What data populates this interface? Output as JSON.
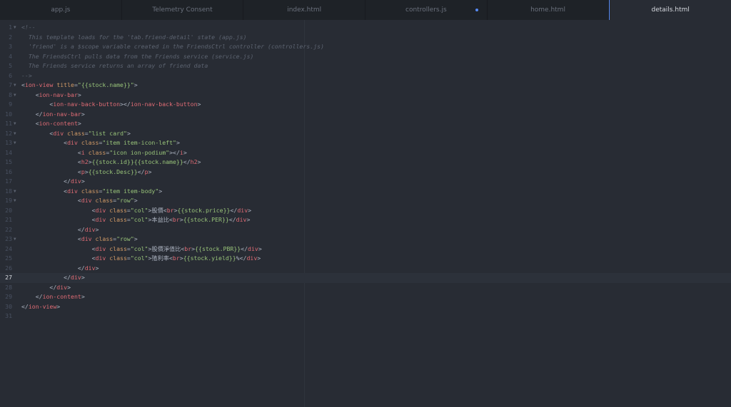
{
  "tabs": [
    {
      "label": "app.js"
    },
    {
      "label": "Telemetry Consent"
    },
    {
      "label": "index.html"
    },
    {
      "label": "controllers.js",
      "modified": true
    },
    {
      "label": "home.html"
    },
    {
      "label": "details.html",
      "active": true
    }
  ],
  "editor": {
    "current_line": 27,
    "lines": [
      {
        "n": "1",
        "fold": true,
        "tokens": [
          {
            "c": "c",
            "t": "<!--"
          }
        ]
      },
      {
        "n": "2",
        "tokens": [
          {
            "c": "c",
            "t": "  This template loads for the 'tab.friend-detail' state (app.js)"
          }
        ]
      },
      {
        "n": "3",
        "tokens": [
          {
            "c": "c",
            "t": "  'friend' is a $scope variable created in the FriendsCtrl controller (controllers.js)"
          }
        ]
      },
      {
        "n": "4",
        "tokens": [
          {
            "c": "c",
            "t": "  The FriendsCtrl pulls data from the Friends service (service.js)"
          }
        ]
      },
      {
        "n": "5",
        "tokens": [
          {
            "c": "c",
            "t": "  The Friends service returns an array of friend data"
          }
        ]
      },
      {
        "n": "6",
        "tokens": [
          {
            "c": "c",
            "t": "-->"
          }
        ]
      },
      {
        "n": "7",
        "fold": true,
        "tokens": [
          {
            "c": "p",
            "t": "<"
          },
          {
            "c": "t",
            "t": "ion-view"
          },
          {
            "c": "p",
            "t": " "
          },
          {
            "c": "a",
            "t": "title"
          },
          {
            "c": "p",
            "t": "="
          },
          {
            "c": "s",
            "t": "\"{{stock.name}}\""
          },
          {
            "c": "p",
            "t": ">"
          }
        ]
      },
      {
        "n": "8",
        "fold": true,
        "tokens": [
          {
            "c": "p",
            "t": "    <"
          },
          {
            "c": "t",
            "t": "ion-nav-bar"
          },
          {
            "c": "p",
            "t": ">"
          }
        ]
      },
      {
        "n": "9",
        "tokens": [
          {
            "c": "p",
            "t": "        <"
          },
          {
            "c": "t",
            "t": "ion-nav-back-button"
          },
          {
            "c": "p",
            "t": "></"
          },
          {
            "c": "t",
            "t": "ion-nav-back-button"
          },
          {
            "c": "p",
            "t": ">"
          }
        ]
      },
      {
        "n": "10",
        "tokens": [
          {
            "c": "p",
            "t": "    </"
          },
          {
            "c": "t",
            "t": "ion-nav-bar"
          },
          {
            "c": "p",
            "t": ">"
          }
        ]
      },
      {
        "n": "11",
        "fold": true,
        "tokens": [
          {
            "c": "p",
            "t": "    <"
          },
          {
            "c": "t",
            "t": "ion-content"
          },
          {
            "c": "p",
            "t": ">"
          }
        ]
      },
      {
        "n": "12",
        "fold": true,
        "tokens": [
          {
            "c": "p",
            "t": "        <"
          },
          {
            "c": "t",
            "t": "div"
          },
          {
            "c": "p",
            "t": " "
          },
          {
            "c": "a",
            "t": "class"
          },
          {
            "c": "p",
            "t": "="
          },
          {
            "c": "s",
            "t": "\"list card\""
          },
          {
            "c": "p",
            "t": ">"
          }
        ]
      },
      {
        "n": "13",
        "fold": true,
        "tokens": [
          {
            "c": "p",
            "t": "            <"
          },
          {
            "c": "t",
            "t": "div"
          },
          {
            "c": "p",
            "t": " "
          },
          {
            "c": "a",
            "t": "class"
          },
          {
            "c": "p",
            "t": "="
          },
          {
            "c": "s",
            "t": "\"item item-icon-left\""
          },
          {
            "c": "p",
            "t": ">"
          }
        ]
      },
      {
        "n": "14",
        "tokens": [
          {
            "c": "p",
            "t": "                <"
          },
          {
            "c": "t",
            "t": "i"
          },
          {
            "c": "p",
            "t": " "
          },
          {
            "c": "a",
            "t": "class"
          },
          {
            "c": "p",
            "t": "="
          },
          {
            "c": "s",
            "t": "\"icon ion-podium\""
          },
          {
            "c": "p",
            "t": "></"
          },
          {
            "c": "t",
            "t": "i"
          },
          {
            "c": "p",
            "t": ">"
          }
        ]
      },
      {
        "n": "15",
        "tokens": [
          {
            "c": "p",
            "t": "                <"
          },
          {
            "c": "t",
            "t": "h2"
          },
          {
            "c": "p",
            "t": ">"
          },
          {
            "c": "s",
            "t": "{{stock.id}}{{stock.name}}"
          },
          {
            "c": "p",
            "t": "</"
          },
          {
            "c": "t",
            "t": "h2"
          },
          {
            "c": "p",
            "t": ">"
          }
        ]
      },
      {
        "n": "16",
        "tokens": [
          {
            "c": "p",
            "t": "                <"
          },
          {
            "c": "t",
            "t": "p"
          },
          {
            "c": "p",
            "t": ">"
          },
          {
            "c": "s",
            "t": "{{stock.Desc}}"
          },
          {
            "c": "p",
            "t": "</"
          },
          {
            "c": "t",
            "t": "p"
          },
          {
            "c": "p",
            "t": ">"
          }
        ]
      },
      {
        "n": "17",
        "tokens": [
          {
            "c": "p",
            "t": "            </"
          },
          {
            "c": "t",
            "t": "div"
          },
          {
            "c": "p",
            "t": ">"
          }
        ]
      },
      {
        "n": "18",
        "fold": true,
        "tokens": [
          {
            "c": "p",
            "t": "            <"
          },
          {
            "c": "t",
            "t": "div"
          },
          {
            "c": "p",
            "t": " "
          },
          {
            "c": "a",
            "t": "class"
          },
          {
            "c": "p",
            "t": "="
          },
          {
            "c": "s",
            "t": "\"item item-body\""
          },
          {
            "c": "p",
            "t": ">"
          }
        ]
      },
      {
        "n": "19",
        "fold": true,
        "tokens": [
          {
            "c": "p",
            "t": "                <"
          },
          {
            "c": "t",
            "t": "div"
          },
          {
            "c": "p",
            "t": " "
          },
          {
            "c": "a",
            "t": "class"
          },
          {
            "c": "p",
            "t": "="
          },
          {
            "c": "s",
            "t": "\"row\""
          },
          {
            "c": "p",
            "t": ">"
          }
        ]
      },
      {
        "n": "20",
        "tokens": [
          {
            "c": "p",
            "t": "                    <"
          },
          {
            "c": "t",
            "t": "div"
          },
          {
            "c": "p",
            "t": " "
          },
          {
            "c": "a",
            "t": "class"
          },
          {
            "c": "p",
            "t": "="
          },
          {
            "c": "s",
            "t": "\"col\""
          },
          {
            "c": "p",
            "t": ">股價<"
          },
          {
            "c": "t",
            "t": "br"
          },
          {
            "c": "p",
            "t": ">"
          },
          {
            "c": "s",
            "t": "{{stock.price}}"
          },
          {
            "c": "p",
            "t": "</"
          },
          {
            "c": "t",
            "t": "div"
          },
          {
            "c": "p",
            "t": ">"
          }
        ]
      },
      {
        "n": "21",
        "tokens": [
          {
            "c": "p",
            "t": "                    <"
          },
          {
            "c": "t",
            "t": "div"
          },
          {
            "c": "p",
            "t": " "
          },
          {
            "c": "a",
            "t": "class"
          },
          {
            "c": "p",
            "t": "="
          },
          {
            "c": "s",
            "t": "\"col\""
          },
          {
            "c": "p",
            "t": ">本益比<"
          },
          {
            "c": "t",
            "t": "br"
          },
          {
            "c": "p",
            "t": ">"
          },
          {
            "c": "s",
            "t": "{{stock.PER}}"
          },
          {
            "c": "p",
            "t": "</"
          },
          {
            "c": "t",
            "t": "div"
          },
          {
            "c": "p",
            "t": ">"
          }
        ]
      },
      {
        "n": "22",
        "tokens": [
          {
            "c": "p",
            "t": "                </"
          },
          {
            "c": "t",
            "t": "div"
          },
          {
            "c": "p",
            "t": ">"
          }
        ]
      },
      {
        "n": "23",
        "fold": true,
        "tokens": [
          {
            "c": "p",
            "t": "                <"
          },
          {
            "c": "t",
            "t": "div"
          },
          {
            "c": "p",
            "t": " "
          },
          {
            "c": "a",
            "t": "class"
          },
          {
            "c": "p",
            "t": "="
          },
          {
            "c": "s",
            "t": "\"row\""
          },
          {
            "c": "p",
            "t": ">"
          }
        ]
      },
      {
        "n": "24",
        "tokens": [
          {
            "c": "p",
            "t": "                    <"
          },
          {
            "c": "t",
            "t": "div"
          },
          {
            "c": "p",
            "t": " "
          },
          {
            "c": "a",
            "t": "class"
          },
          {
            "c": "p",
            "t": "="
          },
          {
            "c": "s",
            "t": "\"col\""
          },
          {
            "c": "p",
            "t": ">股價淨值比<"
          },
          {
            "c": "t",
            "t": "br"
          },
          {
            "c": "p",
            "t": ">"
          },
          {
            "c": "s",
            "t": "{{stock.PBR}}"
          },
          {
            "c": "p",
            "t": "</"
          },
          {
            "c": "t",
            "t": "div"
          },
          {
            "c": "p",
            "t": ">"
          }
        ]
      },
      {
        "n": "25",
        "tokens": [
          {
            "c": "p",
            "t": "                    <"
          },
          {
            "c": "t",
            "t": "div"
          },
          {
            "c": "p",
            "t": " "
          },
          {
            "c": "a",
            "t": "class"
          },
          {
            "c": "p",
            "t": "="
          },
          {
            "c": "s",
            "t": "\"col\""
          },
          {
            "c": "p",
            "t": ">殖利率<"
          },
          {
            "c": "t",
            "t": "br"
          },
          {
            "c": "p",
            "t": ">"
          },
          {
            "c": "s",
            "t": "{{stock.yield}}"
          },
          {
            "c": "p",
            "t": "%</"
          },
          {
            "c": "t",
            "t": "div"
          },
          {
            "c": "p",
            "t": ">"
          }
        ]
      },
      {
        "n": "26",
        "tokens": [
          {
            "c": "p",
            "t": "                </"
          },
          {
            "c": "t",
            "t": "div"
          },
          {
            "c": "p",
            "t": ">"
          }
        ]
      },
      {
        "n": "27",
        "tokens": [
          {
            "c": "p",
            "t": "            </"
          },
          {
            "c": "t",
            "t": "div"
          },
          {
            "c": "p",
            "t": ">"
          }
        ]
      },
      {
        "n": "28",
        "tokens": [
          {
            "c": "p",
            "t": "        </"
          },
          {
            "c": "t",
            "t": "div"
          },
          {
            "c": "p",
            "t": ">"
          }
        ]
      },
      {
        "n": "29",
        "tokens": [
          {
            "c": "p",
            "t": "    </"
          },
          {
            "c": "t",
            "t": "ion-content"
          },
          {
            "c": "p",
            "t": ">"
          }
        ]
      },
      {
        "n": "30",
        "tokens": [
          {
            "c": "p",
            "t": "</"
          },
          {
            "c": "t",
            "t": "ion-view"
          },
          {
            "c": "p",
            "t": ">"
          }
        ]
      },
      {
        "n": "31",
        "tokens": []
      }
    ]
  }
}
